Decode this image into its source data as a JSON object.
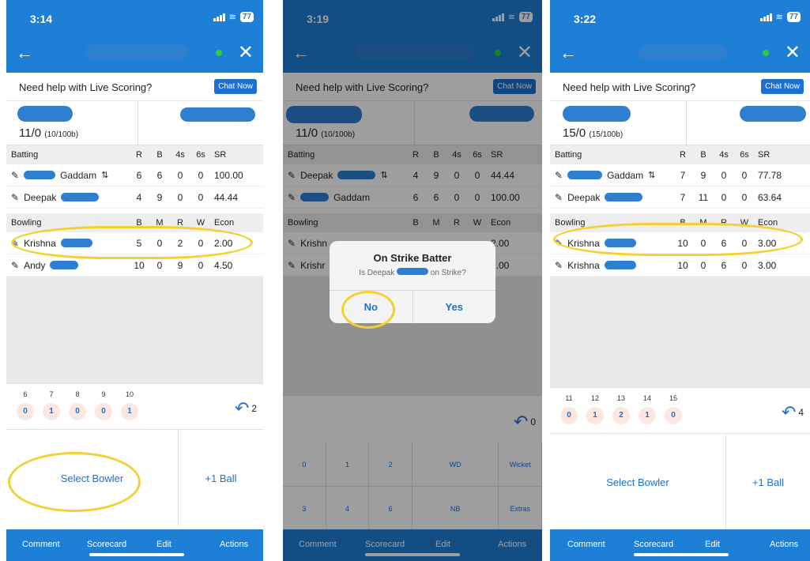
{
  "colors": {
    "brand": "#1e7fd6",
    "highlight": "#f5d033",
    "online": "#2ecc40"
  },
  "icons": {
    "back": "arrow-left-icon",
    "close": "close-icon",
    "edit": "pencil-icon",
    "undo": "undo-icon",
    "swap": "swap-icon"
  },
  "labels": {
    "help": "Need help with Live Scoring?",
    "chat_now": "Chat Now",
    "batting": "Batting",
    "bowling": "Bowling",
    "bat_cols": [
      "R",
      "B",
      "4s",
      "6s",
      "SR"
    ],
    "bowl_cols": [
      "B",
      "M",
      "R",
      "W",
      "Econ"
    ],
    "select_bowler": "Select Bowler",
    "plus_ball": "+1 Ball",
    "nav": [
      "Comment",
      "Scorecard",
      "Edit",
      "Actions"
    ]
  },
  "screens": [
    {
      "time": "3:14",
      "battery": "77",
      "score": "11/0",
      "score_detail": "(10/100b)",
      "batters": [
        {
          "name": "Gaddam",
          "r": "6",
          "b": "6",
          "fours": "0",
          "sixes": "0",
          "sr": "100.00"
        },
        {
          "name": "Deepak",
          "r": "4",
          "b": "9",
          "fours": "0",
          "sixes": "0",
          "sr": "44.44"
        }
      ],
      "bowlers": [
        {
          "name": "Krishna",
          "b": "5",
          "m": "0",
          "r": "2",
          "w": "0",
          "econ": "2.00"
        },
        {
          "name": "Andy",
          "b": "10",
          "m": "0",
          "r": "9",
          "w": "0",
          "econ": "4.50"
        }
      ],
      "balls": [
        {
          "n": "6",
          "v": "0"
        },
        {
          "n": "7",
          "v": "1"
        },
        {
          "n": "8",
          "v": "0"
        },
        {
          "n": "9",
          "v": "0"
        },
        {
          "n": "10",
          "v": "1"
        }
      ],
      "undo_count": "2"
    },
    {
      "time": "3:19",
      "battery": "77",
      "score": "11/0",
      "score_detail": "(10/100b)",
      "batters": [
        {
          "name": "Deepak",
          "r": "4",
          "b": "9",
          "fours": "0",
          "sixes": "0",
          "sr": "44.44"
        },
        {
          "name": "Gaddam",
          "r": "6",
          "b": "6",
          "fours": "0",
          "sixes": "0",
          "sr": "100.00"
        }
      ],
      "bowlers": [
        {
          "name": "Krishn",
          "b": "",
          "m": "",
          "r": "",
          "w": "",
          "econ": "2.00"
        },
        {
          "name": "Krishr",
          "b": "",
          "m": "",
          "r": "",
          "w": "",
          "econ": "2.00"
        }
      ],
      "undo_count": "0",
      "dialog": {
        "title": "On Strike Batter",
        "msg_pre": "Is Deepak",
        "msg_post": "on Strike?",
        "no": "No",
        "yes": "Yes"
      },
      "keypad": [
        "0",
        "1",
        "2",
        "WD",
        "Wicket",
        "3",
        "4",
        "6",
        "NB",
        "Extras"
      ]
    },
    {
      "time": "3:22",
      "battery": "77",
      "score": "15/0",
      "score_detail": "(15/100b)",
      "batters": [
        {
          "name": "Gaddam",
          "r": "7",
          "b": "9",
          "fours": "0",
          "sixes": "0",
          "sr": "77.78"
        },
        {
          "name": "Deepak",
          "r": "7",
          "b": "11",
          "fours": "0",
          "sixes": "0",
          "sr": "63.64"
        }
      ],
      "bowlers": [
        {
          "name": "Krishna",
          "b": "10",
          "m": "0",
          "r": "6",
          "w": "0",
          "econ": "3.00"
        },
        {
          "name": "Krishna",
          "b": "10",
          "m": "0",
          "r": "6",
          "w": "0",
          "econ": "3.00"
        }
      ],
      "balls": [
        {
          "n": "11",
          "v": "0"
        },
        {
          "n": "12",
          "v": "1"
        },
        {
          "n": "13",
          "v": "2"
        },
        {
          "n": "14",
          "v": "1"
        },
        {
          "n": "15",
          "v": "0"
        }
      ],
      "undo_count": "4"
    }
  ]
}
